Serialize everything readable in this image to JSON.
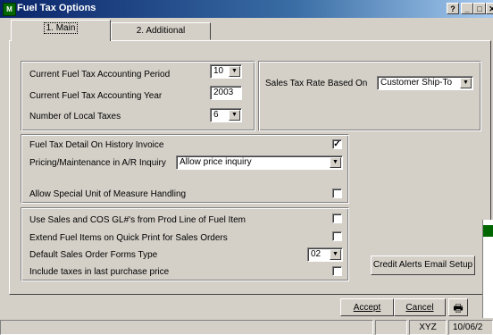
{
  "window": {
    "title": "Fuel Tax Options",
    "help": "?",
    "minimize": "_",
    "maximize": "□",
    "close": "✕"
  },
  "tabs": [
    {
      "label": "1. Main"
    },
    {
      "label": "2. Additional"
    }
  ],
  "period": {
    "label": "Current Fuel Tax Accounting Period",
    "value": "10"
  },
  "year": {
    "label": "Current Fuel Tax Accounting Year",
    "value": "2003"
  },
  "local_taxes": {
    "label": "Number of Local Taxes",
    "value": "6"
  },
  "sales_tax": {
    "label": "Sales Tax Rate Based On",
    "value": "Customer Ship-To"
  },
  "detail_history": {
    "label": "Fuel Tax Detail On History Invoice",
    "checked": "✓"
  },
  "pricing": {
    "label": "Pricing/Maintenance in A/R Inquiry",
    "value": "Allow price inquiry"
  },
  "special_uom": {
    "label": "Allow Special Unit of Measure Handling"
  },
  "use_gl": {
    "label": "Use Sales and COS GL#'s from Prod Line of Fuel Item"
  },
  "extend_fuel": {
    "label": "Extend Fuel Items on Quick Print for Sales Orders"
  },
  "forms_type": {
    "label": "Default Sales Order Forms Type",
    "value": "02"
  },
  "include_taxes": {
    "label": "Include taxes in last purchase price"
  },
  "credit_alerts": {
    "label": "Credit Alerts Email Setup"
  },
  "buttons": {
    "accept": "Accept",
    "cancel": "Cancel"
  },
  "statusbar": {
    "company": "XYZ",
    "date": "10/06/2"
  }
}
